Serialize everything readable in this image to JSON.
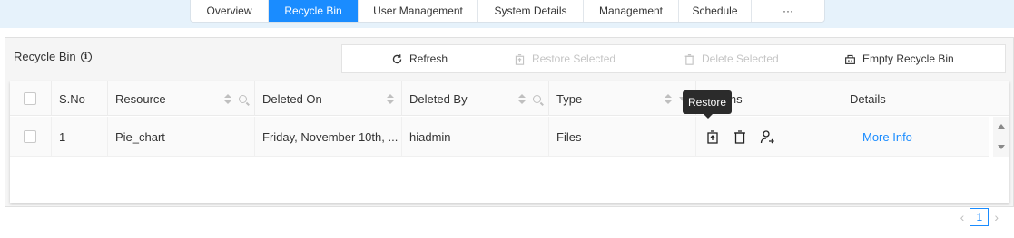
{
  "tabs": [
    {
      "label": "Overview"
    },
    {
      "label": "Recycle Bin"
    },
    {
      "label": "User Management"
    },
    {
      "label": "System Details"
    },
    {
      "label": "Management"
    },
    {
      "label": "Schedule"
    },
    {
      "label": "···"
    }
  ],
  "panel": {
    "title": "Recycle Bin",
    "toolbar": {
      "refresh": "Refresh",
      "restore_selected": "Restore Selected",
      "delete_selected": "Delete Selected",
      "empty_bin": "Empty Recycle Bin"
    }
  },
  "table": {
    "columns": {
      "sno": "S.No",
      "resource": "Resource",
      "deleted_on": "Deleted On",
      "deleted_by": "Deleted By",
      "type": "Type",
      "actions": "Actions",
      "details": "Details"
    },
    "rows": [
      {
        "sno": "1",
        "resource": "Pie_chart",
        "deleted_on": "Friday, November 10th, ...",
        "deleted_by": "hiadmin",
        "type": "Files",
        "details": "More Info"
      }
    ]
  },
  "tooltip": "Restore",
  "pagination": {
    "current_page": "1"
  },
  "colors": {
    "accent": "#1a8cff",
    "topbar": "#e6f2fb"
  }
}
